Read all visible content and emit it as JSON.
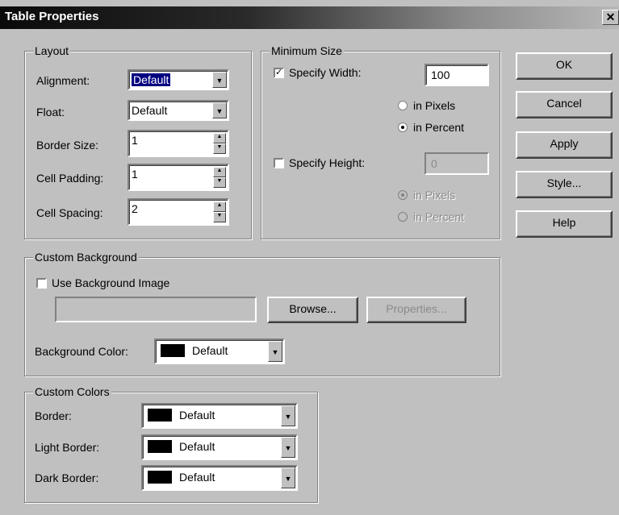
{
  "window": {
    "title": "Table Properties",
    "close_glyph": "✕"
  },
  "layout": {
    "legend": "Layout",
    "alignment_label": "Alignment:",
    "alignment_value": "Default",
    "float_label": "Float:",
    "float_value": "Default",
    "border_size_label": "Border Size:",
    "border_size_value": "1",
    "cell_padding_label": "Cell Padding:",
    "cell_padding_value": "1",
    "cell_spacing_label": "Cell Spacing:",
    "cell_spacing_value": "2"
  },
  "minimum_size": {
    "legend": "Minimum Size",
    "specify_width_label": "Specify Width:",
    "specify_width_checked": true,
    "width_value": "100",
    "width_pixels_label": "in Pixels",
    "width_percent_label": "in Percent",
    "width_unit": "percent",
    "specify_height_label": "Specify Height:",
    "specify_height_checked": false,
    "height_value": "0",
    "height_pixels_label": "in Pixels",
    "height_percent_label": "in Percent",
    "height_unit": "pixels"
  },
  "custom_background": {
    "legend": "Custom Background",
    "use_image_label": "Use Background Image",
    "use_image_checked": false,
    "image_path": "",
    "browse_label": "Browse...",
    "properties_label": "Properties...",
    "bg_color_label": "Background Color:",
    "bg_color_value": "Default"
  },
  "custom_colors": {
    "legend": "Custom Colors",
    "border_label": "Border:",
    "border_value": "Default",
    "light_border_label": "Light Border:",
    "light_border_value": "Default",
    "dark_border_label": "Dark Border:",
    "dark_border_value": "Default"
  },
  "buttons": {
    "ok": "OK",
    "cancel": "Cancel",
    "apply": "Apply",
    "style": "Style...",
    "help": "Help"
  },
  "icons": {
    "dropdown": "▼",
    "spin_up": "▲",
    "spin_down": "▼",
    "check": "✓"
  },
  "colors": {
    "dialog_bg": "#c0c0c0",
    "selection": "#000080",
    "swatch": "#000000"
  }
}
